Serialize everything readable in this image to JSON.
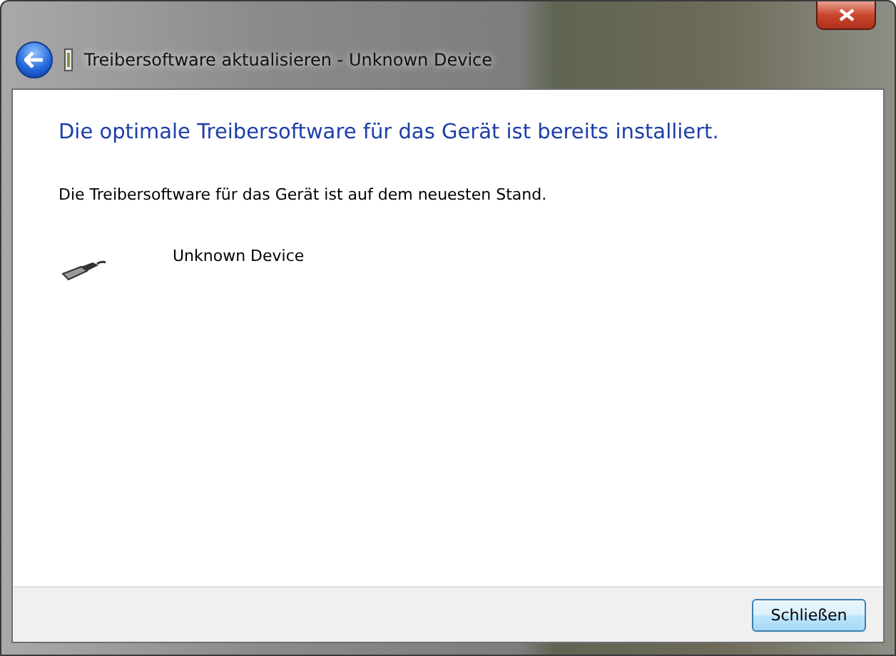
{
  "window": {
    "title": "Treibersoftware aktualisieren - Unknown Device"
  },
  "heading": "Die optimale Treibersoftware für das Gerät ist bereits installiert.",
  "message": "Die Treibersoftware für das Gerät ist auf dem neuesten Stand.",
  "device": {
    "name": "Unknown Device"
  },
  "buttons": [
    "Schließen"
  ]
}
